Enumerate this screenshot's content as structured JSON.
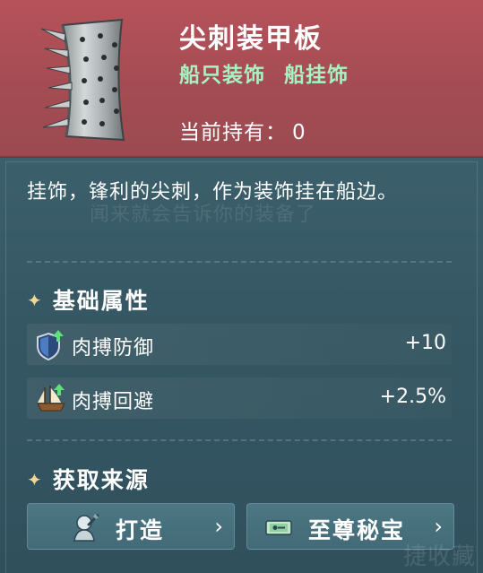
{
  "item": {
    "name": "尖刺装甲板",
    "categories": [
      "船只装饰",
      "船挂饰"
    ],
    "owned_label": "当前持有：",
    "owned_value": "0"
  },
  "description": {
    "text": "挂饰，锋利的尖刺，作为装饰挂在船边。",
    "ghost_text": "闻来就会告诉你的装备了"
  },
  "base_attributes": {
    "title": "基础属性",
    "star_icon": "star-icon",
    "stats": [
      {
        "icon": "shield-up-icon",
        "label": "肉搏防御",
        "value": "+10"
      },
      {
        "icon": "ship-up-icon",
        "label": "肉搏回避",
        "value": "+2.5%"
      }
    ]
  },
  "sources": {
    "title": "获取来源",
    "buttons": [
      {
        "icon": "craft-icon",
        "label": "打造",
        "chevron": "›"
      },
      {
        "icon": "treasure-ticket-icon",
        "label": "至尊秘宝",
        "chevron": "›"
      }
    ]
  },
  "watermark": "捷收藏",
  "colors": {
    "header_bg": "#a44c53",
    "body_bg": "#355764",
    "category_text": "#a8f2c2",
    "star": "#f3d98a",
    "button_bg": "#4d7784"
  }
}
